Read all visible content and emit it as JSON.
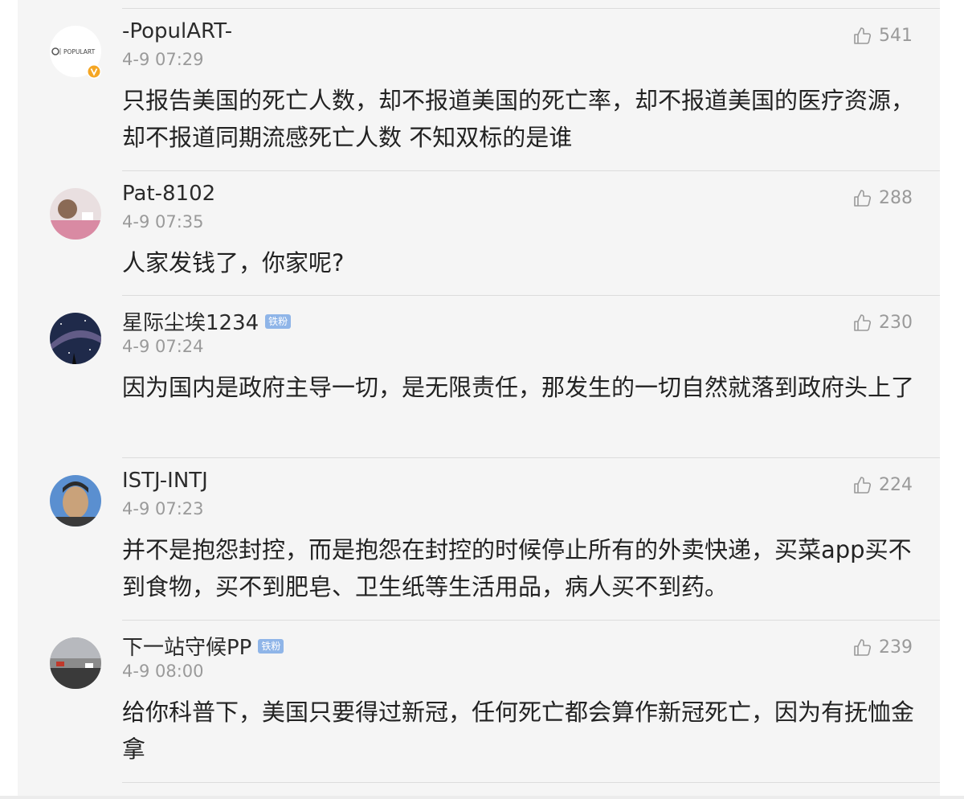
{
  "comments": [
    {
      "username": "-PopulART-",
      "time": "4-9 07:29",
      "likes": "541",
      "badge": "",
      "avatar_logo_text": "POPULART",
      "text": "只报告美国的死亡人数，却不报道美国的死亡率，却不报道美国的医疗资源，却不报道同期流感死亡人数 不知双标的是谁"
    },
    {
      "username": "Pat-8102",
      "time": "4-9 07:35",
      "likes": "288",
      "badge": "",
      "text": "人家发钱了，你家呢?"
    },
    {
      "username": "星际尘埃1234",
      "time": "4-9 07:24",
      "likes": "230",
      "badge": "铁粉",
      "text": "因为国内是政府主导一切，是无限责任，那发生的一切自然就落到政府头上了"
    },
    {
      "username": "ISTJ-INTJ",
      "time": "4-9 07:23",
      "likes": "224",
      "badge": "",
      "text": "并不是抱怨封控，而是抱怨在封控的时候停止所有的外卖快递，买菜app买不到食物，买不到肥皂、卫生纸等生活用品，病人买不到药。"
    },
    {
      "username": "下一站守候PP",
      "time": "4-9 08:00",
      "likes": "239",
      "badge": "铁粉",
      "text": "给你科普下，美国只要得过新冠，任何死亡都会算作新冠死亡，因为有抚恤金拿"
    }
  ],
  "icons": {
    "like": "thumbs-up-icon",
    "verified": "verified-v-icon"
  },
  "colors": {
    "background": "#f5f5f5",
    "badge": "#8fb5e8",
    "verified": "#f5a623",
    "meta_text": "#9a9a9a"
  }
}
